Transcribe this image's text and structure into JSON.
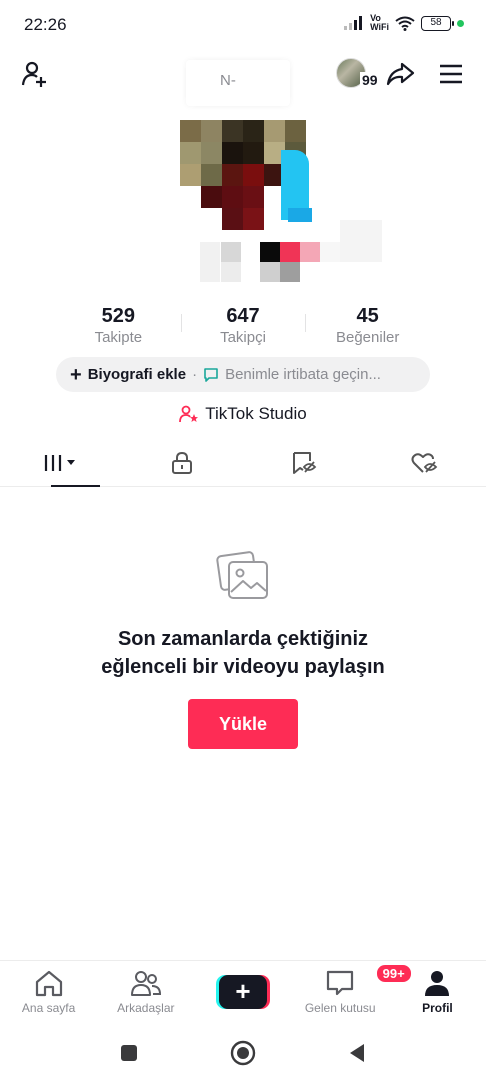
{
  "status_bar": {
    "time": "22:26",
    "network_top": "Vo",
    "network_bottom": "WiFi",
    "battery": "58"
  },
  "header": {
    "username": "N-",
    "notification_count": "99"
  },
  "stats": [
    {
      "value": "529",
      "label": "Takipte"
    },
    {
      "value": "647",
      "label": "Takipçi"
    },
    {
      "value": "45",
      "label": "Beğeniler"
    }
  ],
  "bio": {
    "add_label": "Biyografi ekle",
    "separator": "·",
    "contact_label": "Benimle irtibata geçin..."
  },
  "studio": {
    "label": "TikTok Studio"
  },
  "empty_state": {
    "line1": "Son zamanlarda çektiğiniz",
    "line2": "eğlenceli bir videoyu paylaşın",
    "button": "Yükle"
  },
  "bottom_nav": {
    "home": "Ana sayfa",
    "friends": "Arkadaşlar",
    "create": "+",
    "inbox": "Gelen kutusu",
    "inbox_badge": "99+",
    "profile": "Profil"
  },
  "colors": {
    "accent": "#fe2c55",
    "cyan": "#25f4ee",
    "text": "#161823",
    "secondary": "#8a8b91"
  }
}
